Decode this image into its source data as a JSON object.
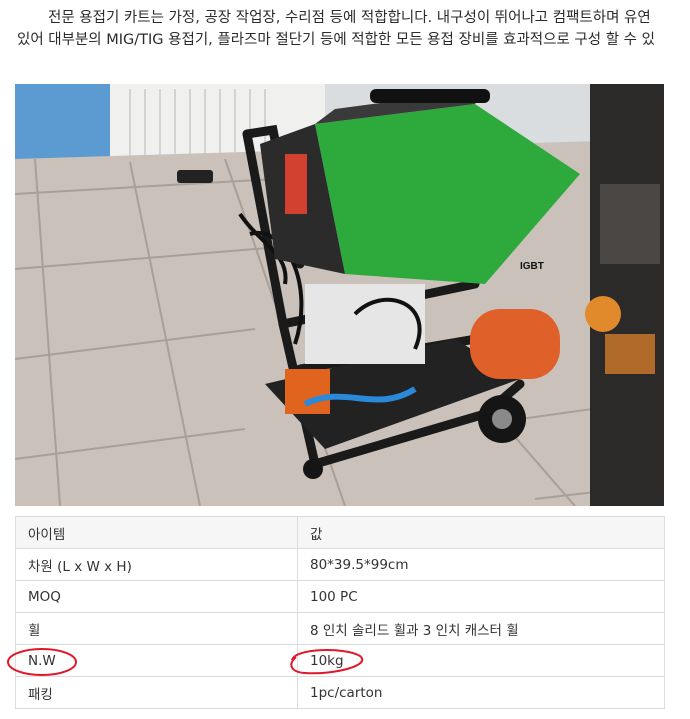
{
  "intro": {
    "line1": "전문 용접기 카트는 가정, 공장 작업장, 수리점 등에 적합합니다. 내구성이 뛰어나고 컴팩트하며 유연",
    "line2": "있어 대부분의 MIG/TIG 용접기, 플라즈마 절단기 등에 적합한 모든 용접 장비를 효과적으로 구성 할 수 있"
  },
  "image": {
    "logo_text": "IGBT"
  },
  "spec_table": {
    "header": {
      "item": "아이템",
      "value": "값"
    },
    "rows": [
      {
        "item": "차원 (L x W x H)",
        "value": "80*39.5*99cm"
      },
      {
        "item": "MOQ",
        "value": "100 PC"
      },
      {
        "item": "휠",
        "value": "8 인치 솔리드 휠과 3 인치 캐스터 휠"
      },
      {
        "item": "N.W",
        "value": "10kg"
      },
      {
        "item": "패킹",
        "value": "1pc/carton"
      }
    ]
  },
  "colors": {
    "welder_green": "#2eaa3c",
    "annotation_red": "#e0182a",
    "table_border": "#dcdcdc"
  }
}
